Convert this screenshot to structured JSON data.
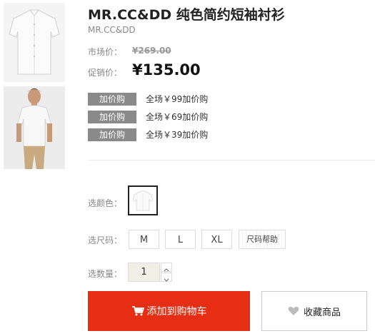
{
  "product": {
    "title": "MR.CC&DD 纯色简约短袖衬衫",
    "brand": "MR.CC&DD",
    "market_price_label": "市场价：",
    "market_price": "¥269.00",
    "sale_price_label": "促销价：",
    "sale_price": "¥135.00"
  },
  "promotions": [
    {
      "tag": "加价购",
      "text": "全场￥99加价购"
    },
    {
      "tag": "加价购",
      "text": "全场￥69加价购"
    },
    {
      "tag": "加价购",
      "text": "全场￥39加价购"
    }
  ],
  "options": {
    "color_label": "选颜色：",
    "size_label": "选尺码：",
    "sizes": [
      "M",
      "L",
      "XL"
    ],
    "size_help": "尺码帮助",
    "quantity_label": "选数量：",
    "quantity": "1"
  },
  "actions": {
    "add_to_cart": "添加到购物车",
    "favorite": "收藏商品"
  },
  "colors": {
    "primary_red": "#e52e13",
    "tag_gray": "#8a8a8a"
  },
  "icons": {
    "cart": "cart-icon",
    "heart": "heart-icon"
  }
}
